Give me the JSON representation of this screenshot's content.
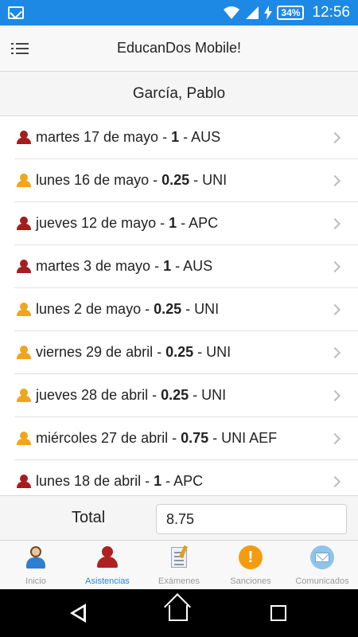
{
  "status_bar": {
    "battery": "34%",
    "time": "12:56",
    "icons": [
      "mail-icon",
      "wifi-icon",
      "signal-icon",
      "charging-icon",
      "battery-icon"
    ]
  },
  "app_bar": {
    "title": "EducanDos Mobile!",
    "menu_icon": "list-menu-icon"
  },
  "student": {
    "name": "García, Pablo"
  },
  "attendance": [
    {
      "date": "martes 17 de mayo",
      "sep1": " - ",
      "value": "1",
      "sep2": " - ",
      "code": "AUS",
      "icon": "person-icon",
      "color": "#a51d1d"
    },
    {
      "date": "lunes 16 de mayo",
      "sep1": " - ",
      "value": "0.25",
      "sep2": " - ",
      "code": "UNI",
      "icon": "person-icon",
      "color": "#f0a51a"
    },
    {
      "date": "jueves 12 de mayo",
      "sep1": " - ",
      "value": "1",
      "sep2": " - ",
      "code": "APC",
      "icon": "person-icon",
      "color": "#a51d1d"
    },
    {
      "date": "martes 3 de mayo",
      "sep1": " - ",
      "value": "1",
      "sep2": " - ",
      "code": "AUS",
      "icon": "person-icon",
      "color": "#a51d1d"
    },
    {
      "date": "lunes 2 de mayo",
      "sep1": " - ",
      "value": "0.25",
      "sep2": " - ",
      "code": "UNI",
      "icon": "person-icon",
      "color": "#f0a51a"
    },
    {
      "date": "viernes 29 de abril",
      "sep1": " - ",
      "value": "0.25",
      "sep2": " - ",
      "code": "UNI",
      "icon": "person-icon",
      "color": "#f0a51a"
    },
    {
      "date": "jueves 28 de abril",
      "sep1": " - ",
      "value": "0.25",
      "sep2": " - ",
      "code": "UNI",
      "icon": "person-icon",
      "color": "#f0a51a"
    },
    {
      "date": "miércoles 27 de abril",
      "sep1": " - ",
      "value": "0.75",
      "sep2": " - ",
      "code": "UNI AEF",
      "icon": "person-icon",
      "color": "#f0a51a"
    },
    {
      "date": "lunes 18 de abril",
      "sep1": " - ",
      "value": "1",
      "sep2": " - ",
      "code": "APC",
      "icon": "person-icon",
      "color": "#a51d1d"
    }
  ],
  "total": {
    "label": "Total",
    "value": "8.75"
  },
  "tabs": [
    {
      "label": "Inicio",
      "icon": "home-user-icon"
    },
    {
      "label": "Asistencias",
      "icon": "attendance-person-icon",
      "active": true
    },
    {
      "label": "Exámenes",
      "icon": "exam-sheet-icon"
    },
    {
      "label": "Sanciones",
      "icon": "warning-icon"
    },
    {
      "label": "Comunicados",
      "icon": "mail-icon"
    }
  ],
  "colors": {
    "status_bar": "#1e88e5",
    "active_tab": "#1e88e5",
    "absence_red": "#a51d1d",
    "partial_orange": "#f0a51a"
  }
}
